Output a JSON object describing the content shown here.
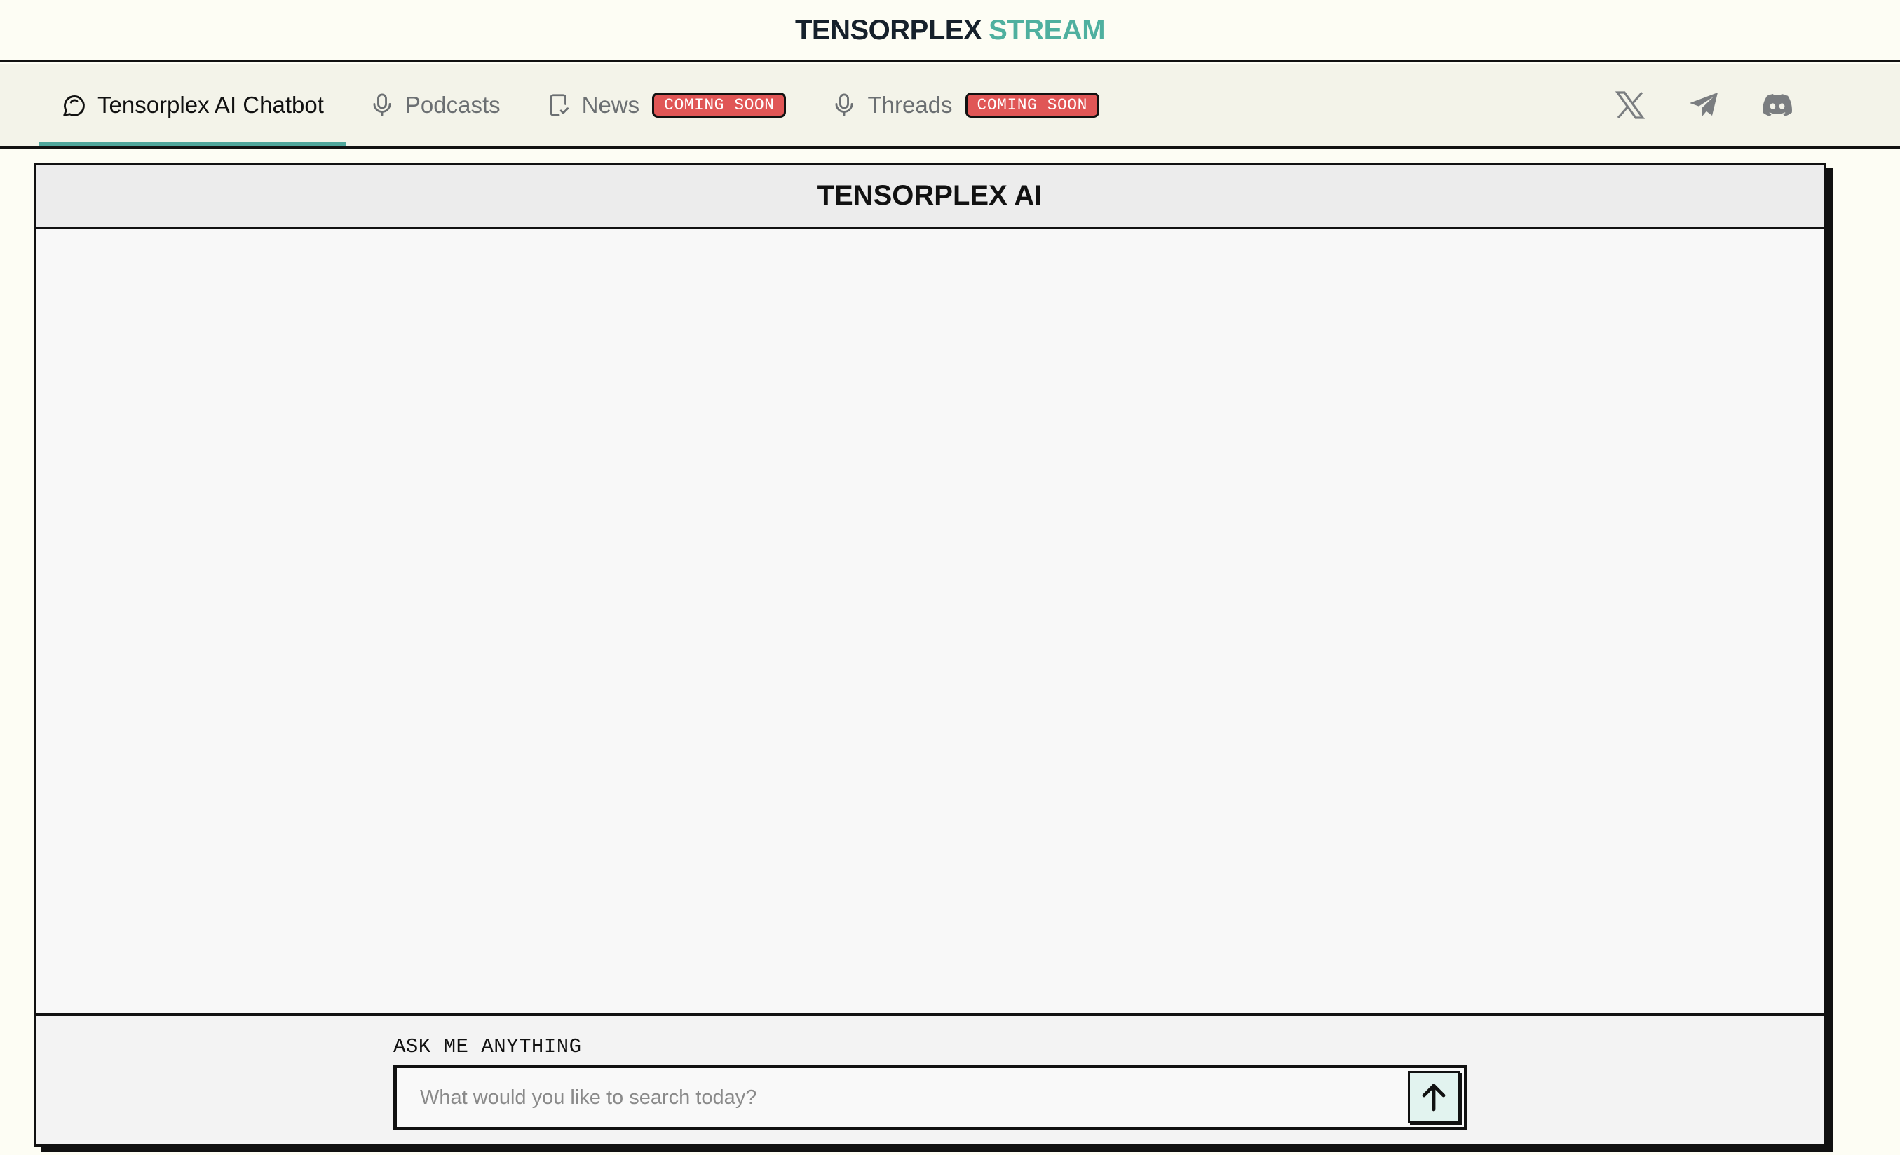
{
  "brand": {
    "part1": "TENSORPLEX",
    "part2": "STREAM",
    "accent_color": "#4fb09f"
  },
  "nav": {
    "tabs": [
      {
        "label": "Tensorplex AI Chatbot",
        "icon": "chat-bubble-icon",
        "active": true
      },
      {
        "label": "Podcasts",
        "icon": "microphone-icon",
        "active": false
      },
      {
        "label": "News",
        "icon": "document-icon",
        "badge": "COMING SOON",
        "active": false
      },
      {
        "label": "Threads",
        "icon": "microphone-icon",
        "badge": "COMING SOON",
        "active": false
      }
    ],
    "socials": [
      "x-icon",
      "telegram-icon",
      "discord-icon"
    ],
    "active_underline_color": "#4fa69b",
    "badge_color": "#e05656"
  },
  "chat": {
    "title": "TENSORPLEX AI",
    "ask_label": "ASK ME ANYTHING",
    "input_placeholder": "What would you like to search today?",
    "input_value": "",
    "send_icon": "arrow-up-icon"
  }
}
